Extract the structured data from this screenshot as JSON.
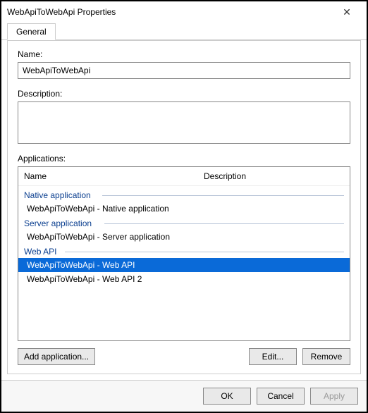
{
  "window": {
    "title": "WebApiToWebApi Properties",
    "close_glyph": "✕"
  },
  "tabs": {
    "general": "General"
  },
  "general": {
    "name_label": "Name:",
    "name_value": "WebApiToWebApi",
    "description_label": "Description:",
    "description_value": "",
    "applications_label": "Applications:",
    "columns": {
      "name": "Name",
      "description": "Description"
    },
    "groups": [
      {
        "heading": "Native application",
        "text_width": 105,
        "items": [
          {
            "label": "WebApiToWebApi - Native application",
            "selected": false
          }
        ]
      },
      {
        "heading": "Server application",
        "text_width": 108,
        "items": [
          {
            "label": "WebApiToWebApi - Server application",
            "selected": false
          }
        ]
      },
      {
        "heading": "Web API",
        "text_width": 52,
        "items": [
          {
            "label": "WebApiToWebApi - Web API",
            "selected": true
          },
          {
            "label": "WebApiToWebApi - Web API 2",
            "selected": false
          }
        ]
      }
    ],
    "buttons": {
      "add": "Add application...",
      "edit": "Edit...",
      "remove": "Remove"
    }
  },
  "footer": {
    "ok": "OK",
    "cancel": "Cancel",
    "apply": "Apply"
  }
}
